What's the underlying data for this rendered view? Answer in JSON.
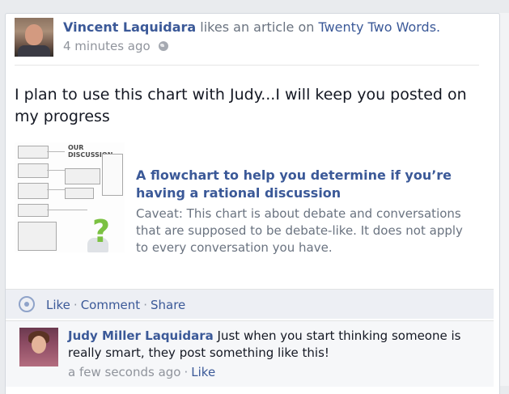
{
  "story": {
    "actor_name": "Vincent Laquidara",
    "action_text": "likes an article on",
    "target_link": "Twenty Two Words.",
    "timestamp": "4 minutes ago",
    "message": "I plan to use this chart with Judy...I will keep you posted on my progress"
  },
  "attachment": {
    "title": "A flowchart to help you determine if you’re having a rational discussion",
    "description": "Caveat: This chart is about debate and conversations that are supposed to be debate-like. It does not apply to every conversation you have.",
    "thumbnail_heading": "OUR DISCUSSION"
  },
  "actions": {
    "like": "Like",
    "comment": "Comment",
    "share": "Share",
    "separator": "·"
  },
  "comment": {
    "author": "Judy Miller Laquidara",
    "text": "Just when you start thinking someone is really smart, they post something like this!",
    "timestamp": "a few seconds ago",
    "like": "Like"
  },
  "icons": {
    "privacy": "globe-icon",
    "like": "like-icon"
  },
  "colors": {
    "link": "#3b5998",
    "muted": "#90949c",
    "action_bar": "#edeff4"
  }
}
